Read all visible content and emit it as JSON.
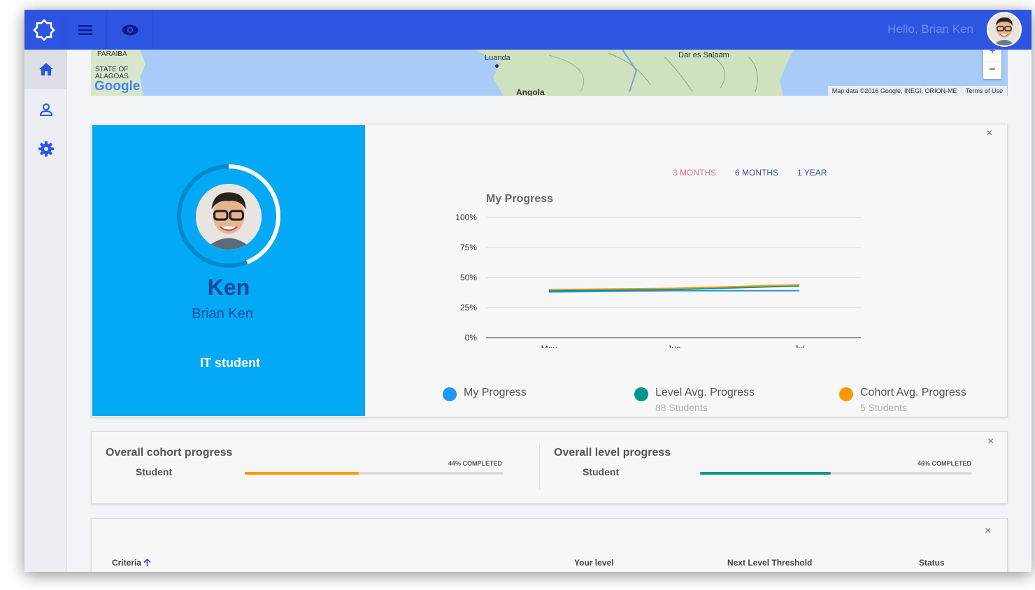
{
  "header": {
    "greeting": "Hello, Brian Ken",
    "icons": [
      "logo-icon",
      "menu-icon",
      "eye-icon"
    ]
  },
  "sidebar": {
    "items": [
      {
        "icon": "home-icon",
        "active": true
      },
      {
        "icon": "person-icon",
        "active": false
      },
      {
        "icon": "gear-icon",
        "active": false
      }
    ]
  },
  "map": {
    "labels": {
      "paraiba": "PARAIBA",
      "state_of": "STATE OF",
      "alagoas": "ALAGOAS",
      "luanda": "Luanda",
      "angola": "Angola",
      "dar": "Dar es Salaam"
    },
    "google": "Google",
    "attribution": "Map data ©2016 Google, INEGI, ORION-ME",
    "terms": "Terms of Use",
    "zoom_in": "+",
    "zoom_out": "−"
  },
  "profile": {
    "nickname": "Ken",
    "full_name": "Brian Ken",
    "role": "IT student",
    "ring_progress": 0.44
  },
  "progress_chart": {
    "close": "×",
    "ranges": [
      {
        "label": "3 MONTHS",
        "active": true
      },
      {
        "label": "6 MONTHS",
        "active": false
      },
      {
        "label": "1 YEAR",
        "active": false
      }
    ],
    "legend": [
      {
        "label": "My Progress",
        "sub": "",
        "color": "#2196f3"
      },
      {
        "label": "Level Avg. Progress",
        "sub": "88 Students",
        "color": "#009688"
      },
      {
        "label": "Cohort Avg. Progress",
        "sub": "5 Students",
        "color": "#ff9800"
      }
    ]
  },
  "chart_data": {
    "type": "line",
    "title": "My Progress",
    "categories": [
      "May",
      "Jun",
      "Jul"
    ],
    "y_ticks": [
      "100%",
      "75%",
      "50%",
      "25%",
      "0%"
    ],
    "ylim": [
      0,
      100
    ],
    "series": [
      {
        "name": "My Progress",
        "color": "#2196f3",
        "values": [
          38,
          39,
          39
        ]
      },
      {
        "name": "Level Avg. Progress",
        "color": "#009688",
        "values": [
          39,
          40,
          43
        ]
      },
      {
        "name": "Cohort Avg. Progress",
        "color": "#ff9800",
        "values": [
          40,
          41,
          44
        ]
      }
    ]
  },
  "overall": {
    "close": "×",
    "cohort": {
      "title": "Overall cohort progress",
      "sub": "Student",
      "pct_label": "44% COMPLETED",
      "value": 0.44,
      "color": "#ff9800"
    },
    "level": {
      "title": "Overall level progress",
      "sub": "Student",
      "pct_label": "46% COMPLETED",
      "value": 0.48,
      "color": "#009688"
    }
  },
  "criteria_table": {
    "close": "×",
    "columns": [
      "Criteria",
      "Your level",
      "Next Level Threshold",
      "Status"
    ],
    "sort_icon": "arrow-up-icon"
  }
}
